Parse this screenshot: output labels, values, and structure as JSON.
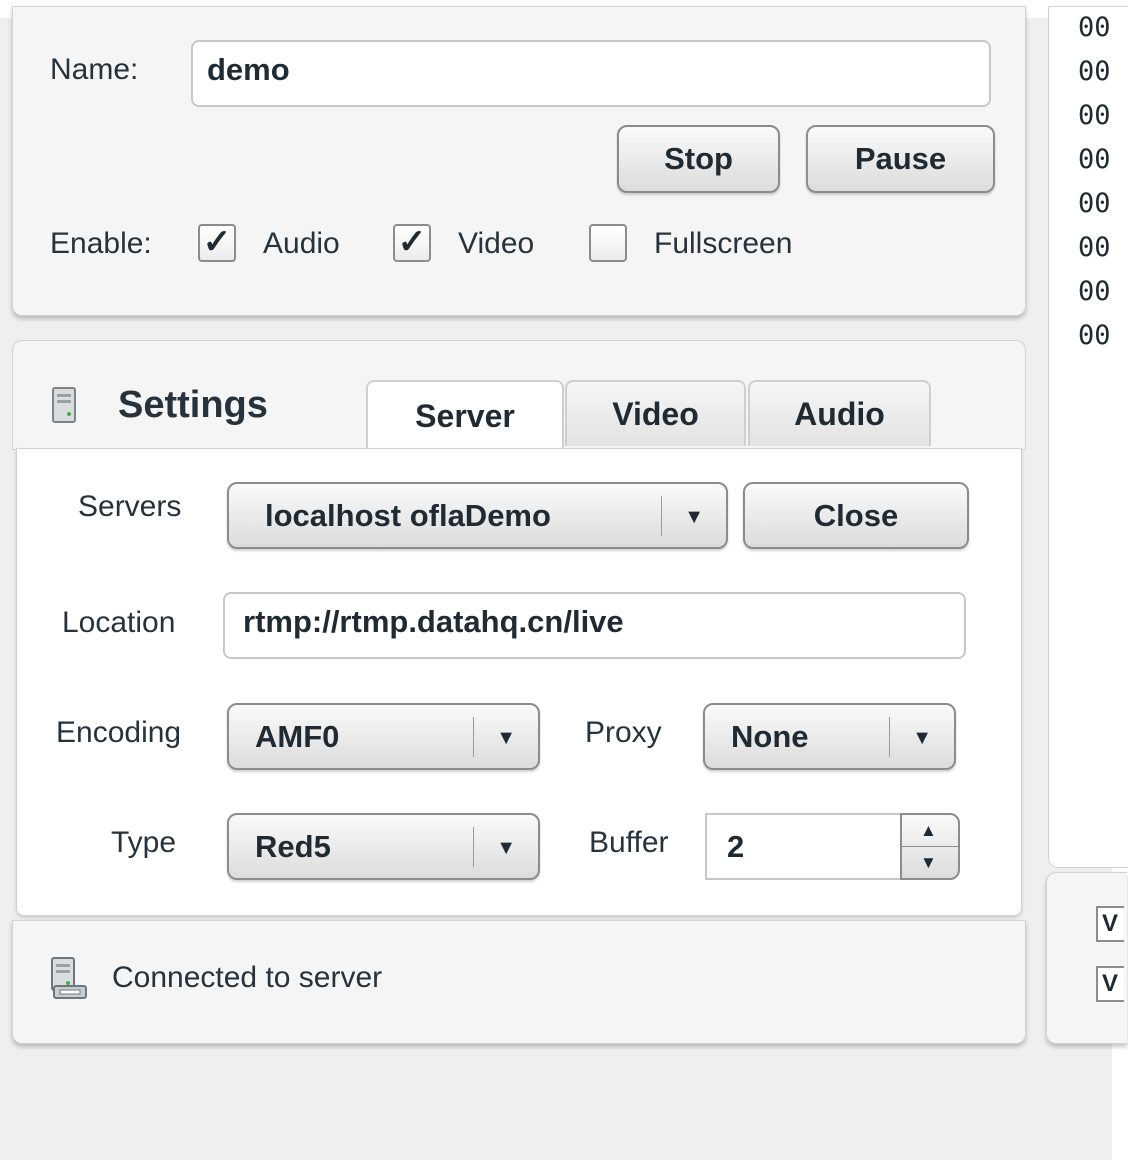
{
  "stream": {
    "name_label": "Name:",
    "name_value": "demo",
    "stop_label": "Stop",
    "pause_label": "Pause",
    "enable_label": "Enable:",
    "audio": {
      "label": "Audio",
      "checked": true,
      "mark": "✓"
    },
    "video": {
      "label": "Video",
      "checked": true,
      "mark": "✓"
    },
    "fullscreen": {
      "label": "Fullscreen",
      "checked": false,
      "mark": ""
    }
  },
  "settings": {
    "title": "Settings",
    "icon": "server-icon",
    "tabs": [
      {
        "label": "Server",
        "active": true
      },
      {
        "label": "Video",
        "active": false
      },
      {
        "label": "Audio",
        "active": false
      }
    ],
    "servers_label": "Servers",
    "servers_value": "localhost oflaDemo",
    "close_label": "Close",
    "location_label": "Location",
    "location_value": "rtmp://rtmp.datahq.cn/live",
    "encoding_label": "Encoding",
    "encoding_value": "AMF0",
    "proxy_label": "Proxy",
    "proxy_value": "None",
    "type_label": "Type",
    "type_value": "Red5",
    "buffer_label": "Buffer",
    "buffer_value": "2"
  },
  "status": {
    "icon": "network-server-icon",
    "text": "Connected to server"
  },
  "log": {
    "lines": [
      "00",
      "00",
      "00",
      "00",
      "00",
      "00",
      "00",
      "00"
    ]
  },
  "right_checks": [
    "V",
    "V"
  ],
  "colors": {
    "panel_bg": "#f5f5f5",
    "app_bg": "#efefef",
    "text": "#1f2a33",
    "border": "#8c8c8c"
  }
}
